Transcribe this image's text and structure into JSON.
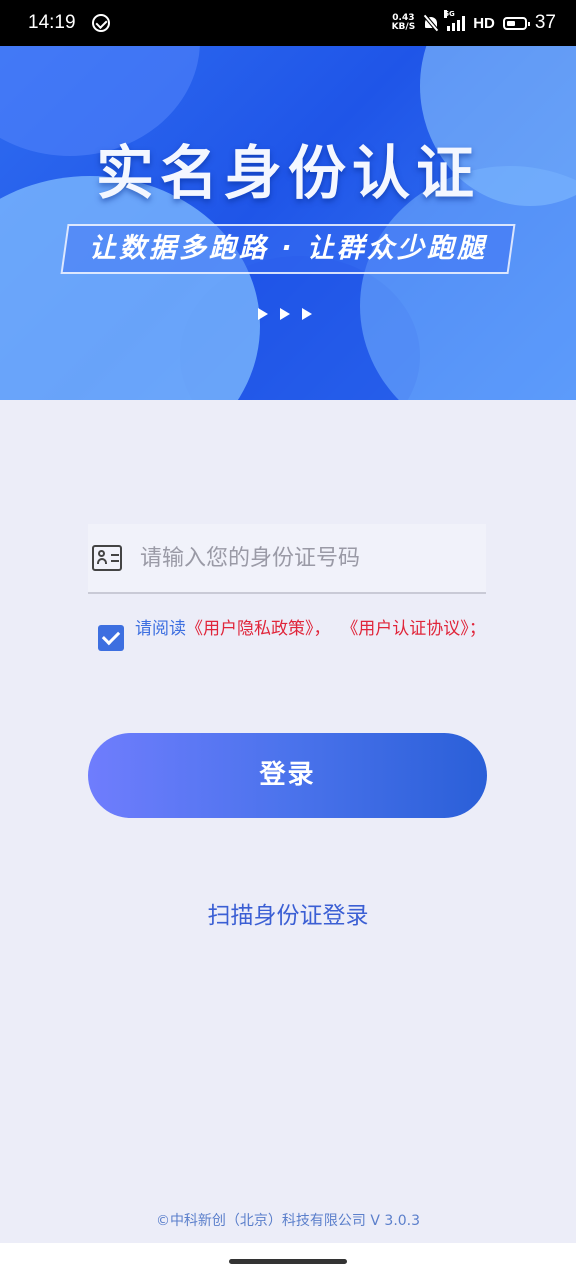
{
  "status_bar": {
    "time": "14:19",
    "net_speed_value": "0.43",
    "net_speed_unit": "KB/S",
    "network_type": "5G",
    "hd": "HD",
    "battery": "37"
  },
  "banner": {
    "title": "实名身份认证",
    "slogan": "让数据多跑路 · 让群众少跑腿"
  },
  "id_field": {
    "placeholder": "请输入您的身份证号码",
    "value": ""
  },
  "agreement": {
    "checked": true,
    "prefix": "请阅读",
    "privacy_link": "《用户隐私政策》",
    "separator": "，",
    "auth_link": "《用户认证协议》",
    "suffix": "；"
  },
  "login_button": "登录",
  "scan_link": "扫描身份证登录",
  "copyright": "©中科新创（北京）科技有限公司 V 3.0.3",
  "colors": {
    "primary": "#3d6fe0",
    "link_red": "#e0253a",
    "background": "#ecedf8"
  }
}
